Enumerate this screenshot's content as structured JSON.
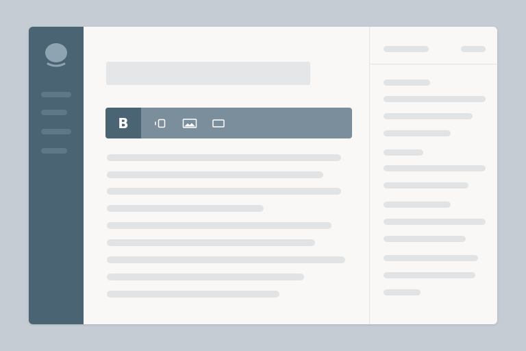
{
  "window": {
    "title_field": {
      "value": "",
      "placeholder": ""
    }
  },
  "sidebar": {
    "logo_icon": "speech-bubble-logo",
    "items": [
      {
        "label": ""
      },
      {
        "label": ""
      },
      {
        "label": ""
      },
      {
        "label": ""
      }
    ]
  },
  "toolbar": {
    "buttons": [
      {
        "label": "B",
        "icon": "bold-icon",
        "active": true
      },
      {
        "icon": "embed-icon",
        "active": false
      },
      {
        "icon": "image-icon",
        "active": false
      },
      {
        "icon": "box-icon",
        "active": false
      }
    ]
  },
  "editor": {
    "paragraph_lines": 9
  },
  "right_panel": {
    "header": {
      "title": "",
      "action": ""
    },
    "groups": 4
  },
  "colors": {
    "background": "#c6ccd4",
    "window": "#faf8f6",
    "sidebar": "#4b6474",
    "toolbar": "#7a8e9c",
    "toolbar_active": "#4b6474",
    "placeholder_line": "#e2e3e4"
  }
}
